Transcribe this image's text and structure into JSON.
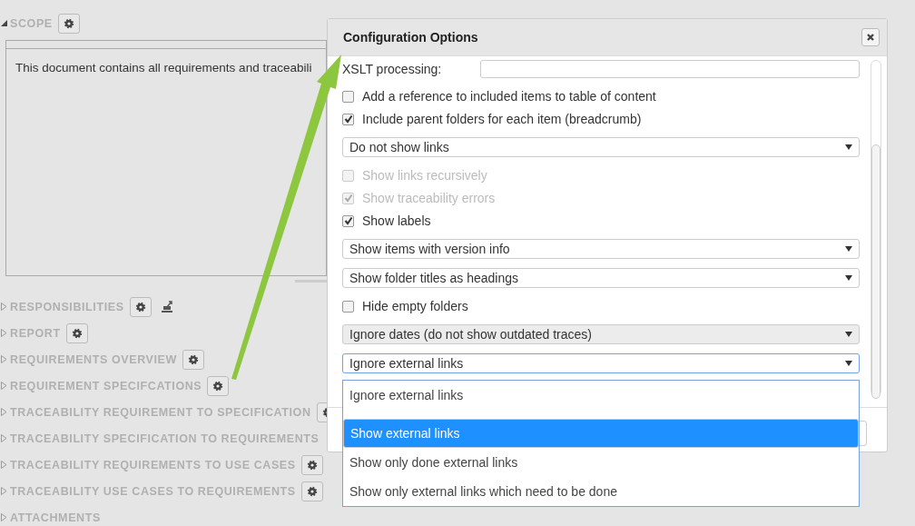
{
  "sections_top": [
    {
      "title": "SCOPE",
      "expanded": true,
      "has_gear": true
    }
  ],
  "scope_text": "This document contains all requirements and traceabili",
  "sections": [
    {
      "title": "RESPONSIBILITIES",
      "expanded": false,
      "has_gear": true,
      "has_export": true
    },
    {
      "title": "REPORT",
      "expanded": false,
      "has_gear": true,
      "has_export": false
    },
    {
      "title": "REQUIREMENTS OVERVIEW",
      "expanded": false,
      "has_gear": true,
      "has_export": false
    },
    {
      "title": "REQUIREMENT SPECIFCATIONS",
      "expanded": false,
      "has_gear": true,
      "has_export": false
    },
    {
      "title": "TRACEABILITY REQUIREMENT TO SPECIFICATION",
      "expanded": false,
      "has_gear": true,
      "has_export": false
    },
    {
      "title": "TRACEABILITY SPECIFICATION TO REQUIREMENTS",
      "expanded": false,
      "has_gear": false,
      "has_export": false
    },
    {
      "title": "TRACEABILITY REQUIREMENTS TO USE CASES",
      "expanded": false,
      "has_gear": true,
      "has_export": false
    },
    {
      "title": "TRACEABILITY USE CASES TO REQUIREMENTS",
      "expanded": false,
      "has_gear": true,
      "has_export": false
    },
    {
      "title": "ATTACHMENTS",
      "expanded": false,
      "has_gear": false,
      "has_export": false
    }
  ],
  "dialog": {
    "title": "Configuration Options",
    "items": [
      {
        "kind": "field",
        "label": "XSLT processing:"
      },
      {
        "kind": "checkbox",
        "label": "Add a reference to included items to table of content",
        "checked": false,
        "disabled": false
      },
      {
        "kind": "checkbox",
        "label": "Include parent folders for each item (breadcrumb)",
        "checked": true,
        "disabled": false
      },
      {
        "kind": "select",
        "value": "Do not show links",
        "disabled": false,
        "focused": false
      },
      {
        "kind": "checkbox",
        "label": "Show links recursively",
        "checked": false,
        "disabled": true
      },
      {
        "kind": "checkbox",
        "label": "Show traceability errors",
        "checked": true,
        "disabled": true
      },
      {
        "kind": "checkbox",
        "label": "Show labels",
        "checked": true,
        "disabled": false
      },
      {
        "kind": "select",
        "value": "Show items with version info",
        "disabled": false,
        "focused": false
      },
      {
        "kind": "select",
        "value": "Show folder titles as headings",
        "disabled": false,
        "focused": false
      },
      {
        "kind": "checkbox",
        "label": "Hide empty folders",
        "checked": false,
        "disabled": false
      },
      {
        "kind": "select",
        "value": "Ignore dates (do not show outdated traces)",
        "disabled": true,
        "focused": false
      },
      {
        "kind": "select",
        "value": "Ignore external links",
        "disabled": false,
        "focused": true
      }
    ],
    "dropdown_options": [
      {
        "label": "Ignore external links",
        "selected": false
      },
      {
        "label": "Show external links",
        "selected": true
      },
      {
        "label": "Show only done external links",
        "selected": false
      },
      {
        "label": "Show only external links which need to be done",
        "selected": false
      }
    ]
  }
}
